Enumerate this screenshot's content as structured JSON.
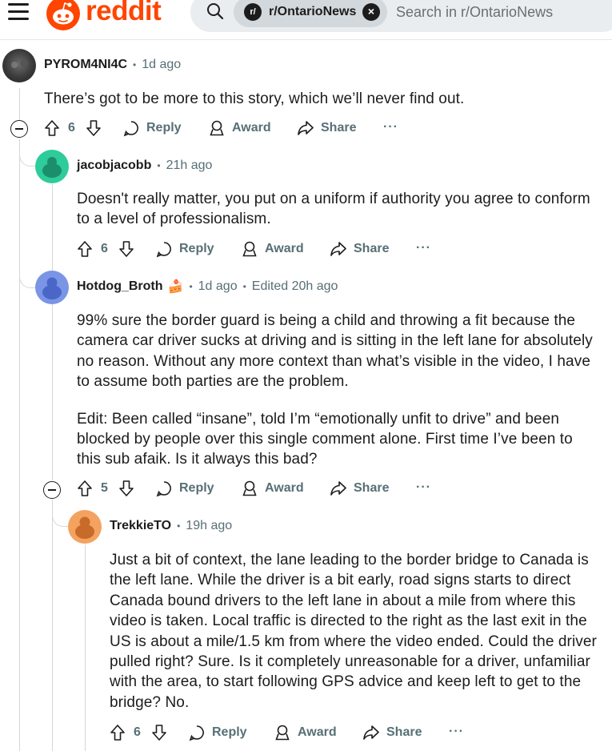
{
  "header": {
    "logo_text": "reddit",
    "subreddit_chip": "r/OntarioNews",
    "subreddit_icon": "r/",
    "search_placeholder": "Search in r/OntarioNews",
    "brand_color": "#ff4500"
  },
  "actions": {
    "reply": "Reply",
    "award": "Award",
    "share": "Share",
    "more": "···"
  },
  "comments": [
    {
      "author": "PYROM4NI4C",
      "time": "1d ago",
      "body": [
        "There’s got to be more to this story, which we’ll never find out."
      ],
      "votes": "6"
    },
    {
      "author": "jacobjacobb",
      "time": "21h ago",
      "body": [
        "Doesn't really matter, you put on a uniform if authority you agree to conform to a level of professionalism."
      ],
      "votes": "6"
    },
    {
      "author": "Hotdog_Broth",
      "flair_emoji": "🍰",
      "time": "1d ago",
      "edited": "Edited 20h ago",
      "body": [
        "99% sure the border guard is being a child and throwing a fit because the camera car driver sucks at driving and is sitting in the left lane for absolutely no reason. Without any more context than what’s visible in the video, I have to assume both parties are the problem.",
        "Edit: Been called “insane”, told I’m “emotionally unfit to drive” and been blocked by people over this single comment alone. First time I’ve been to this sub afaik. Is it always this bad?"
      ],
      "votes": "5"
    },
    {
      "author": "TrekkieTO",
      "time": "19h ago",
      "body": [
        "Just a bit of context, the lane leading to the border bridge to Canada is the left lane. While the driver is a bit early, road signs starts to direct Canada bound drivers to the left lane in about a mile from where this video is taken. Local traffic is directed to the right as the last exit in the US is about a mile/1.5 km from where the video ended. Could the driver pulled right? Sure. Is it completely unreasonable for a driver, unfamiliar with the area, to start following GPS advice and keep left to get to the bridge? No."
      ],
      "votes": "6"
    }
  ]
}
